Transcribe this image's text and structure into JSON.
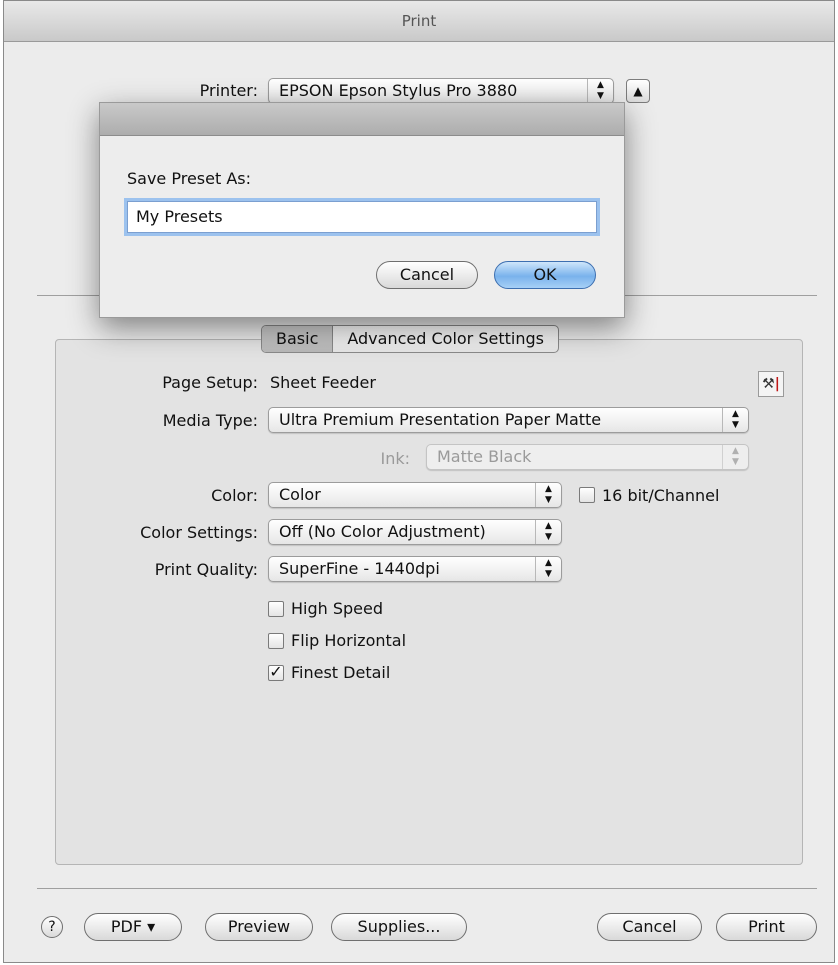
{
  "window": {
    "title": "Print"
  },
  "printer": {
    "label": "Printer:",
    "value": "EPSON Epson Stylus Pro 3880"
  },
  "save_dialog": {
    "prompt": "Save Preset As:",
    "input_value": "My Presets",
    "cancel_label": "Cancel",
    "ok_label": "OK"
  },
  "tabs": [
    {
      "label": "Basic",
      "selected": true
    },
    {
      "label": "Advanced Color Settings",
      "selected": false
    }
  ],
  "settings": {
    "page_setup_label": "Page Setup:",
    "page_setup_value": "Sheet Feeder",
    "media_type_label": "Media Type:",
    "media_type_value": "Ultra Premium Presentation Paper Matte",
    "ink_label": "Ink:",
    "ink_value": "Matte Black",
    "color_label": "Color:",
    "color_value": "Color",
    "sixteen_bit_label": "16 bit/Channel",
    "sixteen_bit_checked": false,
    "color_settings_label": "Color Settings:",
    "color_settings_value": "Off (No Color Adjustment)",
    "print_quality_label": "Print Quality:",
    "print_quality_value": "SuperFine - 1440dpi"
  },
  "options": [
    {
      "label": "High Speed",
      "checked": false
    },
    {
      "label": "Flip Horizontal",
      "checked": false
    },
    {
      "label": "Finest Detail",
      "checked": true
    }
  ],
  "bottom": {
    "help": "?",
    "pdf_label": "PDF ▾",
    "preview_label": "Preview",
    "supplies_label": "Supplies...",
    "cancel_label": "Cancel",
    "print_label": "Print"
  },
  "icons": {
    "stepper": "up-down-arrows",
    "disclosure": "triangle-up",
    "checkmark": "check",
    "tools": "wrench-thermometer"
  },
  "colors": {
    "default_button": "#79b2ec",
    "focus_ring": "#9cc2ee"
  }
}
